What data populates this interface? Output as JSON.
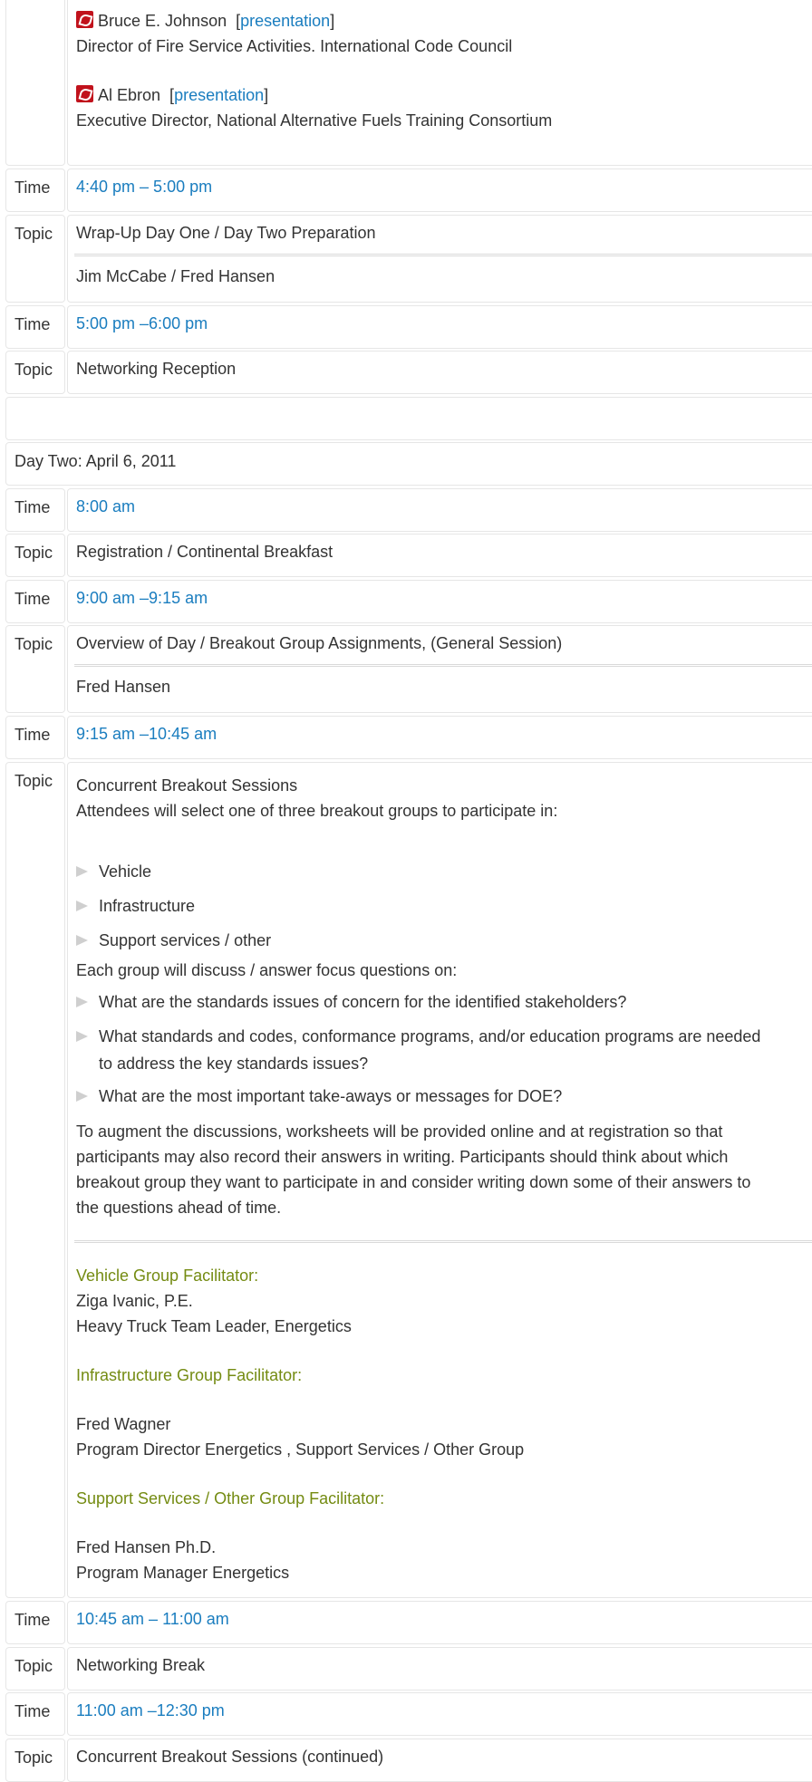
{
  "speakers": [
    {
      "name": "Bruce E. Johnson",
      "link": "presentation",
      "title": "Director of Fire Service Activities. International Code Council"
    },
    {
      "name": "Al Ebron",
      "link": "presentation",
      "title": "Executive Director, National Alternative Fuels Training Consortium"
    }
  ],
  "labels": {
    "time": "Time",
    "topic": "Topic"
  },
  "wrapup": {
    "time": "4:40 pm – 5:00 pm",
    "topic": "Wrap-Up Day One / Day Two Preparation",
    "speakers": "Jim McCabe / Fred Hansen"
  },
  "reception": {
    "time": "5:00 pm –6:00 pm",
    "topic": "Networking Reception"
  },
  "day_two": "Day Two: April 6, 2011",
  "registration": {
    "time": "8:00 am",
    "topic": "Registration / Continental Breakfast"
  },
  "overview": {
    "time": "9:00 am –9:15 am",
    "topic": "Overview of Day / Breakout Group Assignments, (General Session)",
    "speaker": "Fred Hansen"
  },
  "breakout": {
    "time": "9:15 am –10:45 am",
    "title": "Concurrent Breakout Sessions",
    "intro": "Attendees will select one of three breakout groups to participate in:",
    "groups": [
      "Vehicle",
      "Infrastructure",
      "Support services / other"
    ],
    "focus_intro": "Each group will discuss / answer focus questions on:",
    "q1": "What are the standards issues of concern for the identified stakeholders?",
    "q2a": "What standards and codes, conformance programs, and/or education programs are needed",
    "q2b": "to address the key standards issues?",
    "q3": "What are the most important take-aways or messages for DOE?",
    "para": [
      "To augment the discussions, worksheets will be provided online and at registration so that",
      "participants may also record their answers in writing. Participants should think about which",
      "breakout group they want to participate in and consider writing down some of their answers to",
      "the questions ahead of time."
    ],
    "vehicle_head": "Vehicle Group Facilitator:",
    "vehicle_name": "Ziga Ivanic, P.E.",
    "vehicle_role": "Heavy Truck Team Leader, Energetics",
    "infra_head": "Infrastructure Group Facilitator:",
    "infra_name": "Fred Wagner",
    "infra_role": "Program Director Energetics , Support Services / Other Group",
    "support_head": "Support Services / Other Group Facilitator:",
    "support_name": "Fred Hansen Ph.D.",
    "support_role": "Program Manager Energetics"
  },
  "netbreak": {
    "time": "10:45 am – 11:00 am",
    "topic": "Networking Break"
  },
  "continued": {
    "time": "11:00 am –12:30 pm",
    "topic": "Concurrent Breakout Sessions (continued)"
  }
}
